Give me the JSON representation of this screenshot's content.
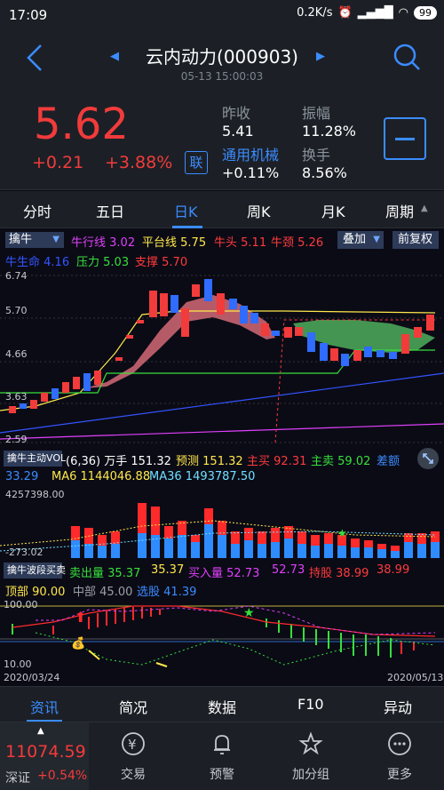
{
  "status": {
    "time": "17:09",
    "net": "0.2K/s",
    "battery": "99"
  },
  "header": {
    "title": "云内动力(000903)",
    "datetime": "05-13 15:00:03"
  },
  "quote": {
    "price": "5.62",
    "change": "+0.21",
    "change_pct": "+3.88%",
    "lian": "联",
    "prev_close_label": "昨收",
    "prev_close": "5.41",
    "amplitude_label": "振幅",
    "amplitude": "11.28%",
    "sector_label": "通用机械",
    "sector_change": "+0.11%",
    "turnover_label": "换手",
    "turnover": "8.56%"
  },
  "tabs": [
    "分时",
    "五日",
    "日K",
    "周K",
    "月K",
    "周期"
  ],
  "main_ind": {
    "selector": "擒牛",
    "line1": [
      {
        "label": "牛行线",
        "value": "3.02",
        "color": "#e040fb"
      },
      {
        "label": "平台线",
        "value": "5.75",
        "color": "#ffe84a"
      },
      {
        "label": "牛头",
        "value": "5.11",
        "color": "#ff3b3b"
      },
      {
        "label": "牛颈",
        "value": "5.26",
        "color": "#ff3b3b"
      }
    ],
    "line2": [
      {
        "label": "牛生命",
        "value": "4.16",
        "color": "#3355ff"
      },
      {
        "label": "压力",
        "value": "5.03",
        "color": "#36e03b"
      },
      {
        "label": "支撑",
        "value": "5.70",
        "color": "#ff3b3b"
      }
    ],
    "overlay_btn": "叠加",
    "adjust_btn": "前复权"
  },
  "price_axis": [
    "6.74",
    "5.70",
    "4.66",
    "3.63",
    "2.59"
  ],
  "vol_ind": {
    "selector": "擒牛主动VOL",
    "params": "(6,36)",
    "unit": "万手",
    "line1": [
      {
        "label": "",
        "value": "151.32",
        "color": "#ffffff"
      },
      {
        "label": "预测",
        "value": "151.32",
        "color": "#ffe84a"
      },
      {
        "label": "主买",
        "value": "92.31",
        "color": "#ff3b3b"
      },
      {
        "label": "主卖",
        "value": "59.02",
        "color": "#36e03b"
      },
      {
        "label": "差额",
        "value": "",
        "color": "#3b8cff"
      }
    ],
    "line2": [
      {
        "label": "",
        "value": "33.29",
        "color": "#3b8cff"
      },
      {
        "label": "MA6",
        "value": "1144046.88",
        "color": "#ffe84a"
      },
      {
        "label": "MA36",
        "value": "1493787.50",
        "color": "#6ee0ff"
      }
    ],
    "axis_top": "4257398.00",
    "axis_bottom": "-273.02"
  },
  "wave_ind": {
    "selector": "擒牛波段买卖",
    "line1": [
      {
        "label": "卖出量",
        "value": "35.37",
        "color": "#36e03b"
      },
      {
        "label": "",
        "value": "35.37",
        "color": "#ffe84a"
      },
      {
        "label": "买入量",
        "value": "52.73",
        "color": "#e040fb"
      },
      {
        "label": "",
        "value": "52.73",
        "color": "#e040fb"
      },
      {
        "label": "持股",
        "value": "38.99",
        "color": "#ff3b3b"
      },
      {
        "label": "",
        "value": "38.99",
        "color": "#ff3b3b"
      }
    ],
    "line2": [
      {
        "label": "顶部",
        "value": "90.00",
        "color": "#ffe84a"
      },
      {
        "label": "中部",
        "value": "45.00",
        "color": "#9aa0a6"
      },
      {
        "label": "选股",
        "value": "41.39",
        "color": "#3b8cff"
      }
    ],
    "axis_top": "100.00",
    "axis_bottom": "10.00",
    "date_start": "2020/03/24",
    "date_end": "2020/05/13"
  },
  "bottom_tabs": [
    "资讯",
    "简况",
    "数据",
    "F10",
    "异动"
  ],
  "index": {
    "value": "11074.59",
    "name": "深证",
    "change": "+0.54%"
  },
  "nav": [
    {
      "label": "交易",
      "icon": "yen-icon"
    },
    {
      "label": "预警",
      "icon": "bell-icon"
    },
    {
      "label": "加分组",
      "icon": "star-icon"
    },
    {
      "label": "更多",
      "icon": "more-icon"
    }
  ],
  "colors": {
    "up": "#f23b3b",
    "down": "#2f6cff",
    "accent": "#3b8cff",
    "bg": "#0b0b16"
  }
}
